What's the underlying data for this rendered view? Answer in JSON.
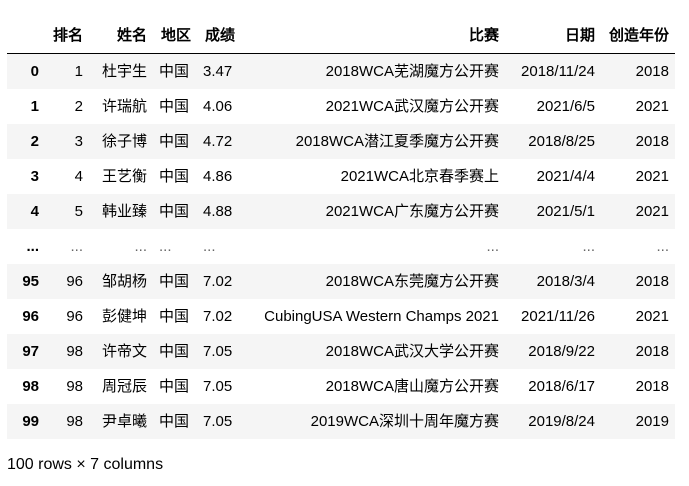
{
  "dataframe": {
    "columns": [
      "",
      "排名",
      "姓名",
      "地区",
      "成绩",
      "比赛",
      "日期",
      "创造年份"
    ],
    "rows": [
      {
        "index": "0",
        "cells": [
          "1",
          "杜宇生",
          "中国",
          "3.47",
          "2018WCA芜湖魔方公开赛",
          "2018/11/24",
          "2018"
        ]
      },
      {
        "index": "1",
        "cells": [
          "2",
          "许瑞航",
          "中国",
          "4.06",
          "2021WCA武汉魔方公开赛",
          "2021/6/5",
          "2021"
        ]
      },
      {
        "index": "2",
        "cells": [
          "3",
          "徐子博",
          "中国",
          "4.72",
          "2018WCA潜江夏季魔方公开赛",
          "2018/8/25",
          "2018"
        ]
      },
      {
        "index": "3",
        "cells": [
          "4",
          "王艺衡",
          "中国",
          "4.86",
          "2021WCA北京春季赛上",
          "2021/4/4",
          "2021"
        ]
      },
      {
        "index": "4",
        "cells": [
          "5",
          "韩业臻",
          "中国",
          "4.88",
          "2021WCA广东魔方公开赛",
          "2021/5/1",
          "2021"
        ]
      },
      {
        "index": "...",
        "cells": [
          "...",
          "...",
          "...",
          "...",
          "...",
          "...",
          "..."
        ]
      },
      {
        "index": "95",
        "cells": [
          "96",
          "邹胡杨",
          "中国",
          "7.02",
          "2018WCA东莞魔方公开赛",
          "2018/3/4",
          "2018"
        ]
      },
      {
        "index": "96",
        "cells": [
          "96",
          "彭健坤",
          "中国",
          "7.02",
          "CubingUSA Western Champs 2021",
          "2021/11/26",
          "2021"
        ]
      },
      {
        "index": "97",
        "cells": [
          "98",
          "许帝文",
          "中国",
          "7.05",
          "2018WCA武汉大学公开赛",
          "2018/9/22",
          "2018"
        ]
      },
      {
        "index": "98",
        "cells": [
          "98",
          "周冠辰",
          "中国",
          "7.05",
          "2018WCA唐山魔方公开赛",
          "2018/6/17",
          "2018"
        ]
      },
      {
        "index": "99",
        "cells": [
          "98",
          "尹卓曦",
          "中国",
          "7.05",
          "2019WCA深圳十周年魔方赛",
          "2019/8/24",
          "2019"
        ]
      }
    ],
    "shape": "100 rows × 7 columns"
  }
}
